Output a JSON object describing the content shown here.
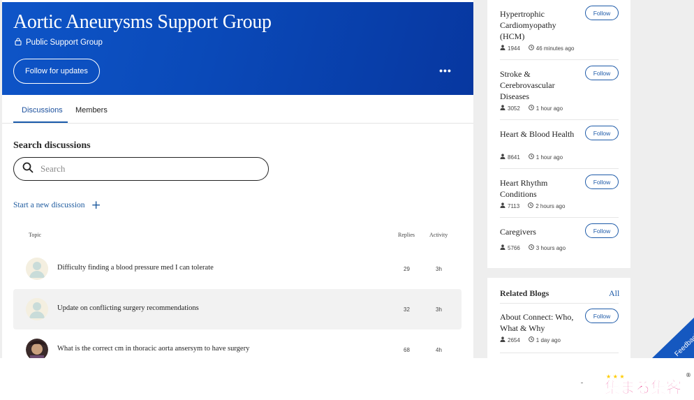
{
  "group": {
    "title": "Aortic Aneurysms Support Group",
    "visibility": "Public Support Group",
    "follow_label": "Follow for updates",
    "more_label": "•••"
  },
  "tabs": {
    "discussions": "Discussions",
    "members": "Members"
  },
  "search": {
    "heading": "Search discussions",
    "placeholder": "Search"
  },
  "start_discussion": {
    "label": "Start a new discussion",
    "plus": "+"
  },
  "table": {
    "headers": {
      "topic": "Topic",
      "replies": "Replies",
      "activity": "Activity"
    },
    "rows": [
      {
        "title": "Difficulty finding a blood pressure med I can tolerate",
        "replies": "29",
        "activity": "3h",
        "avatar": "default-avatar-icon",
        "highlighted": false
      },
      {
        "title": "Update on conflicting surgery recommendations",
        "replies": "32",
        "activity": "3h",
        "avatar": "default-avatar-icon",
        "highlighted": true
      },
      {
        "title": "What is the correct cm in thoracic aorta ansersym to have surgery",
        "replies": "68",
        "activity": "4h",
        "avatar": "user-photo",
        "highlighted": false
      }
    ]
  },
  "sidebar": {
    "groups": [
      {
        "name": "Hypertrophic Cardiomyopathy (HCM)",
        "members": "1944",
        "time": "46 minutes ago",
        "follow": "Follow"
      },
      {
        "name": "Stroke & Cerebrovascular Diseases",
        "members": "3052",
        "time": "1 hour ago",
        "follow": "Follow"
      },
      {
        "name": "Heart & Blood Health",
        "members": "8641",
        "time": "1 hour ago",
        "follow": "Follow"
      },
      {
        "name": "Heart Rhythm Conditions",
        "members": "7113",
        "time": "2 hours ago",
        "follow": "Follow"
      },
      {
        "name": "Caregivers",
        "members": "5766",
        "time": "3 hours ago",
        "follow": "Follow"
      }
    ],
    "blogs": {
      "title": "Related Blogs",
      "all": "All",
      "items": [
        {
          "name": "About Connect: Who, What & Why",
          "members": "2654",
          "time": "1 day ago",
          "follow": "Follow"
        }
      ]
    }
  },
  "feedback": {
    "label": "Feedback"
  },
  "logo": {
    "text": "集まる集客",
    "mark": "®"
  },
  "colors": {
    "hero_start": "#0e55c8",
    "hero_end": "#0737a0",
    "accent": "#1d5aa8",
    "feedback": "#1558c0",
    "logo_pink": "#e8287f",
    "logo_yellow": "#ffcc00"
  }
}
